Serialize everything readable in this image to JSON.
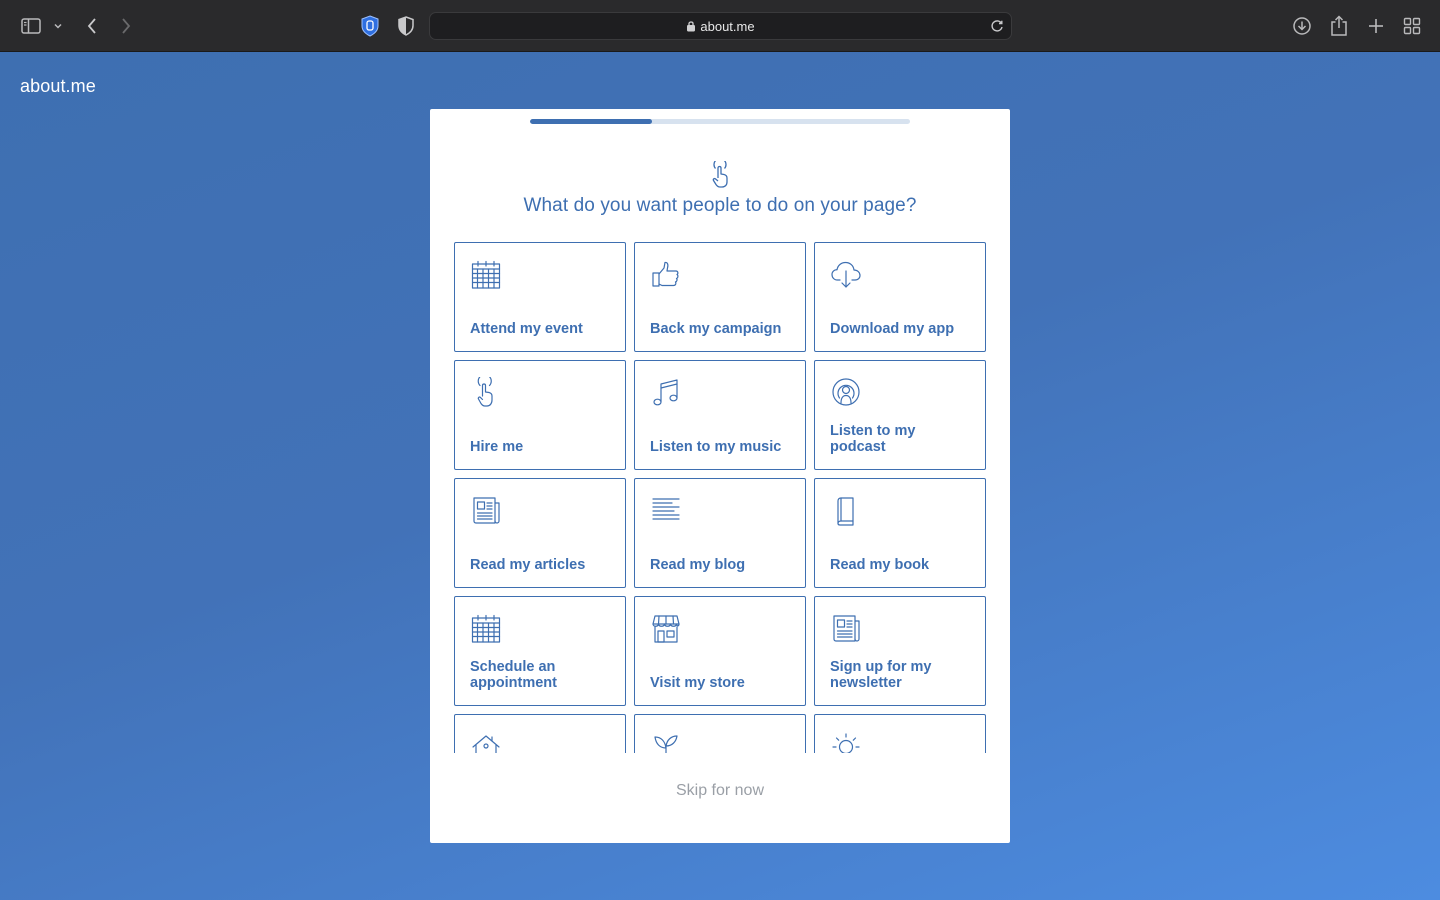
{
  "browser": {
    "url": "about.me",
    "icons": [
      "sidebar-icon",
      "chevron-down-icon",
      "back-icon",
      "forward-icon",
      "privacy-hand-icon",
      "shield-icon",
      "lock-icon",
      "reload-icon",
      "download-icon",
      "share-icon",
      "new-tab-icon",
      "tab-overview-icon"
    ]
  },
  "page": {
    "logo": "about.me",
    "progress_percent": 32,
    "question": "What do you want people to do on your page?",
    "options": [
      {
        "label": "Attend my event",
        "icon": "calendar-icon"
      },
      {
        "label": "Back my campaign",
        "icon": "thumbs-up-icon"
      },
      {
        "label": "Download my app",
        "icon": "cloud-download-icon"
      },
      {
        "label": "Hire me",
        "icon": "pointer-hand-icon"
      },
      {
        "label": "Listen to my music",
        "icon": "music-note-icon"
      },
      {
        "label": "Listen to my podcast",
        "icon": "podcast-icon"
      },
      {
        "label": "Read my articles",
        "icon": "newspaper-icon"
      },
      {
        "label": "Read my blog",
        "icon": "text-lines-icon"
      },
      {
        "label": "Read my book",
        "icon": "book-icon"
      },
      {
        "label": "Schedule an appointment",
        "icon": "calendar-icon"
      },
      {
        "label": "Visit my store",
        "icon": "storefront-icon"
      },
      {
        "label": "Sign up for my newsletter",
        "icon": "newspaper-icon"
      },
      {
        "label": "",
        "icon": "house-icon"
      },
      {
        "label": "",
        "icon": "plant-icon"
      },
      {
        "label": "",
        "icon": "lightbulb-icon"
      }
    ],
    "skip_label": "Skip for now"
  },
  "colors": {
    "brand": "#3e6fb1",
    "background": "#4272b8",
    "skip_text": "#9a9fa6"
  }
}
